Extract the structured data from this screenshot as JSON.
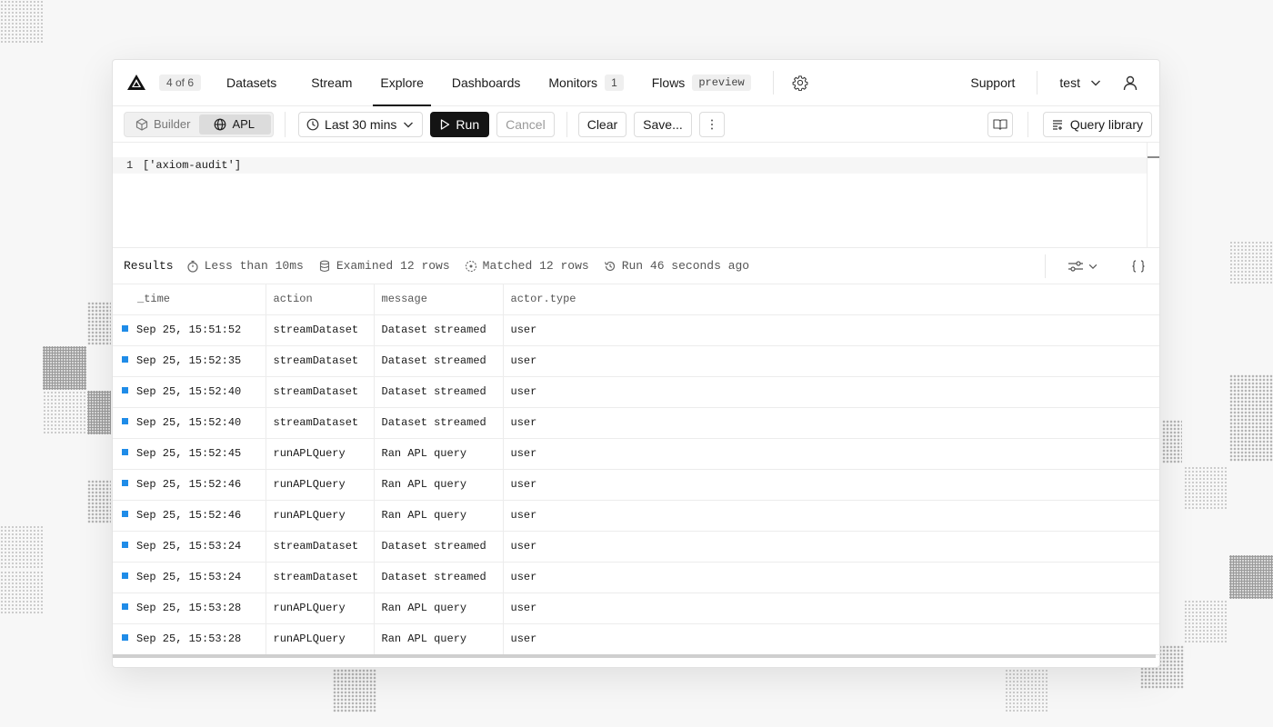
{
  "nav": {
    "counter": "4 of 6",
    "items": [
      {
        "label": "Datasets"
      },
      {
        "label": "Stream"
      },
      {
        "label": "Explore"
      },
      {
        "label": "Dashboards"
      },
      {
        "label": "Monitors",
        "badge": "1"
      },
      {
        "label": "Flows",
        "badge": "preview"
      }
    ],
    "active": "Explore",
    "support": "Support",
    "org": "test"
  },
  "toolbar": {
    "mode_builder": "Builder",
    "mode_apl": "APL",
    "active_mode": "APL",
    "time_range": "Last 30 mins",
    "run": "Run",
    "cancel": "Cancel",
    "clear": "Clear",
    "save": "Save...",
    "query_library": "Query library"
  },
  "editor": {
    "line_number": "1",
    "code": "['axiom-audit']"
  },
  "results": {
    "title": "Results",
    "duration": "Less than 10ms",
    "examined": "Examined 12 rows",
    "matched": "Matched 12 rows",
    "run_ago": "Run 46 seconds ago"
  },
  "table": {
    "columns": [
      "_time",
      "action",
      "message",
      "actor.type"
    ],
    "rows": [
      [
        "Sep 25, 15:51:52",
        "streamDataset",
        "Dataset streamed",
        "user"
      ],
      [
        "Sep 25, 15:52:35",
        "streamDataset",
        "Dataset streamed",
        "user"
      ],
      [
        "Sep 25, 15:52:40",
        "streamDataset",
        "Dataset streamed",
        "user"
      ],
      [
        "Sep 25, 15:52:40",
        "streamDataset",
        "Dataset streamed",
        "user"
      ],
      [
        "Sep 25, 15:52:45",
        "runAPLQuery",
        "Ran APL query",
        "user"
      ],
      [
        "Sep 25, 15:52:46",
        "runAPLQuery",
        "Ran APL query",
        "user"
      ],
      [
        "Sep 25, 15:52:46",
        "runAPLQuery",
        "Ran APL query",
        "user"
      ],
      [
        "Sep 25, 15:53:24",
        "streamDataset",
        "Dataset streamed",
        "user"
      ],
      [
        "Sep 25, 15:53:24",
        "streamDataset",
        "Dataset streamed",
        "user"
      ],
      [
        "Sep 25, 15:53:28",
        "runAPLQuery",
        "Ran APL query",
        "user"
      ],
      [
        "Sep 25, 15:53:28",
        "runAPLQuery",
        "Ran APL query",
        "user"
      ]
    ]
  },
  "colors": {
    "row_marker": "#1f8ce8",
    "run_button": "#141414"
  }
}
